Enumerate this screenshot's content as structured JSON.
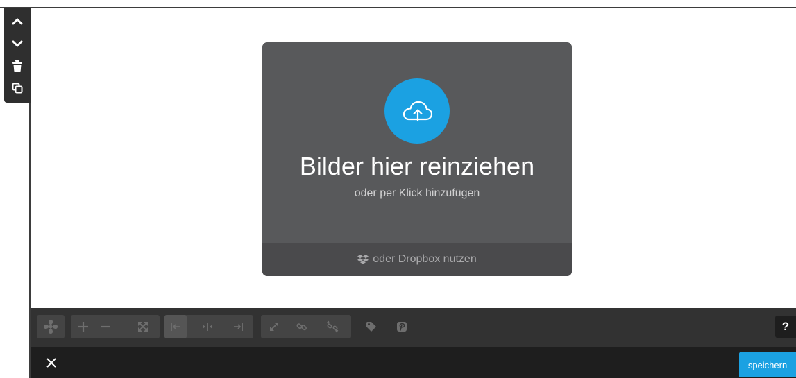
{
  "side_toolbar": {
    "icons": [
      "chevron-up-icon",
      "chevron-down-icon",
      "trash-icon",
      "duplicate-icon"
    ]
  },
  "upload": {
    "title": "Bilder hier reinziehen",
    "subtitle": "oder per Klick hinzufügen",
    "dropbox_label": "oder Dropbox nutzen",
    "icon": "cloud-upload-icon",
    "accent": "#1ba1e2"
  },
  "toolbar": {
    "icons": [
      "slideshow-icon",
      "zoom-in-icon",
      "zoom-out-icon",
      "fullscreen-icon",
      "align-left-icon",
      "align-center-icon",
      "align-right-icon",
      "expand-icon",
      "link-icon",
      "unlink-icon",
      "tag-icon",
      "pinterest-icon"
    ],
    "help_label": "?"
  },
  "footer": {
    "close_icon": "close-icon",
    "save_label": "speichern"
  }
}
